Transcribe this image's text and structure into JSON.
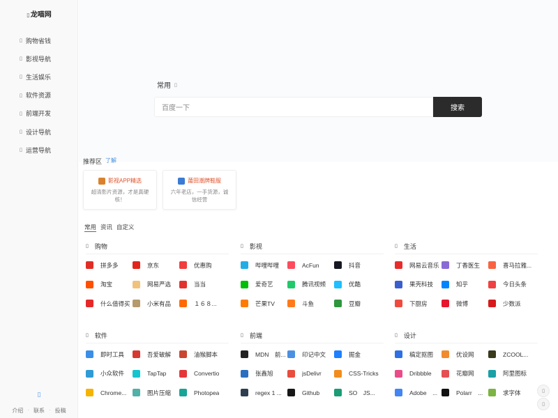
{
  "sidebar": {
    "logo": "龙喵网",
    "items": [
      {
        "label": "购物省钱"
      },
      {
        "label": "影视导航"
      },
      {
        "label": "生活娱乐"
      },
      {
        "label": "软件资源"
      },
      {
        "label": "前端开发"
      },
      {
        "label": "设计导航"
      },
      {
        "label": "运营导航"
      }
    ],
    "bottom_links": [
      "介绍",
      "联系",
      "投稿"
    ]
  },
  "search": {
    "tab": "常用",
    "placeholder": "百度一下",
    "button": "搜索"
  },
  "recommend": {
    "title": "推荐区",
    "more": "了解",
    "cards": [
      {
        "title": "影视APP精选",
        "desc": "超清影片资源，才是真硬核！",
        "icon_color": "#d9822b"
      },
      {
        "title": "莆田潮牌鞋服",
        "desc": "六年老店，一手货源，诚信经营",
        "icon_color": "#3a7bd5"
      }
    ]
  },
  "category_tabs": [
    "常用",
    "资讯",
    "自定义"
  ],
  "sections": [
    {
      "title": "购物",
      "links": [
        {
          "name": "拼多多",
          "color": "#e02e24"
        },
        {
          "name": "京东",
          "color": "#e1251b"
        },
        {
          "name": "优惠购",
          "color": "#f23d3d"
        },
        {
          "name": "淘宝",
          "color": "#ff5000"
        },
        {
          "name": "网易严选",
          "color": "#f0c27b"
        },
        {
          "name": "当当",
          "color": "#e3322e"
        },
        {
          "name": "什么值得买",
          "color": "#e62828"
        },
        {
          "name": "小米有品",
          "color": "#b59a6e"
        },
        {
          "name": "１６８...",
          "color": "#ff6a00"
        }
      ]
    },
    {
      "title": "影视",
      "links": [
        {
          "name": "哔哩哔哩",
          "color": "#23ade5"
        },
        {
          "name": "AcFun",
          "color": "#fd4c5d"
        },
        {
          "name": "抖音",
          "color": "#161823"
        },
        {
          "name": "爱奇艺",
          "color": "#00be06"
        },
        {
          "name": "腾讯视频",
          "color": "#21c96b"
        },
        {
          "name": "优酷",
          "color": "#1ebeff"
        },
        {
          "name": "芒果TV",
          "color": "#ff7a00"
        },
        {
          "name": "斗鱼",
          "color": "#ff7a1a"
        },
        {
          "name": "豆瓣",
          "color": "#2e963d"
        }
      ]
    },
    {
      "title": "生活",
      "links": [
        {
          "name": "网易云音乐",
          "color": "#e72d2c"
        },
        {
          "name": "丁香医生",
          "color": "#8a6bd6"
        },
        {
          "name": "喜马拉雅...",
          "color": "#f86442"
        },
        {
          "name": "果壳科技",
          "color": "#3a5fcd"
        },
        {
          "name": "知乎",
          "color": "#0084ff"
        },
        {
          "name": "今日头条",
          "color": "#f04142"
        },
        {
          "name": "下厨房",
          "color": "#ee4b3e"
        },
        {
          "name": "微博",
          "color": "#e6162d"
        },
        {
          "name": "少数派",
          "color": "#d71a1b"
        }
      ]
    },
    {
      "title": "软件",
      "links": [
        {
          "name": "即时工具",
          "color": "#3b8ee8"
        },
        {
          "name": "吾爱破解",
          "color": "#d6392f"
        },
        {
          "name": "油猴脚本",
          "color": "#c9452f"
        },
        {
          "name": "小众软件",
          "color": "#2f9bd6"
        },
        {
          "name": "TapTap",
          "color": "#15c5ce"
        },
        {
          "name": "Convertio",
          "color": "#e5373a"
        },
        {
          "name": "Chrome...",
          "color": "#f4b400"
        },
        {
          "name": "图片压缩",
          "color": "#4fb1a8"
        },
        {
          "name": "Photopea",
          "color": "#18a497"
        }
      ]
    },
    {
      "title": "前端",
      "links": [
        {
          "name": "MDN　前...",
          "color": "#222222"
        },
        {
          "name": "印记中文",
          "color": "#4a90e2"
        },
        {
          "name": "掘金",
          "color": "#1e80ff"
        },
        {
          "name": "张鑫旭",
          "color": "#2a6fbf"
        },
        {
          "name": "jsDelivr",
          "color": "#e84d3d"
        },
        {
          "name": "CSS-Tricks",
          "color": "#f28c1e"
        },
        {
          "name": "regex 1 ...",
          "color": "#2c3e50"
        },
        {
          "name": "Github",
          "color": "#181717"
        },
        {
          "name": "SO　JS...",
          "color": "#1a9c75"
        }
      ]
    },
    {
      "title": "设计",
      "links": [
        {
          "name": "稿定抠图",
          "color": "#2f6fe4"
        },
        {
          "name": "优设网",
          "color": "#f08c2e"
        },
        {
          "name": "ZCOOL...",
          "color": "#3a3a1c"
        },
        {
          "name": "Dribbble",
          "color": "#ea4c89"
        },
        {
          "name": "花瓣网",
          "color": "#e54e53"
        },
        {
          "name": "阿里图标",
          "color": "#1ba0a6"
        },
        {
          "name": "Adobe　...",
          "color": "#4285f4"
        },
        {
          "name": "Polarr　...",
          "color": "#111111"
        },
        {
          "name": "求字体",
          "color": "#7cb342"
        }
      ]
    }
  ]
}
